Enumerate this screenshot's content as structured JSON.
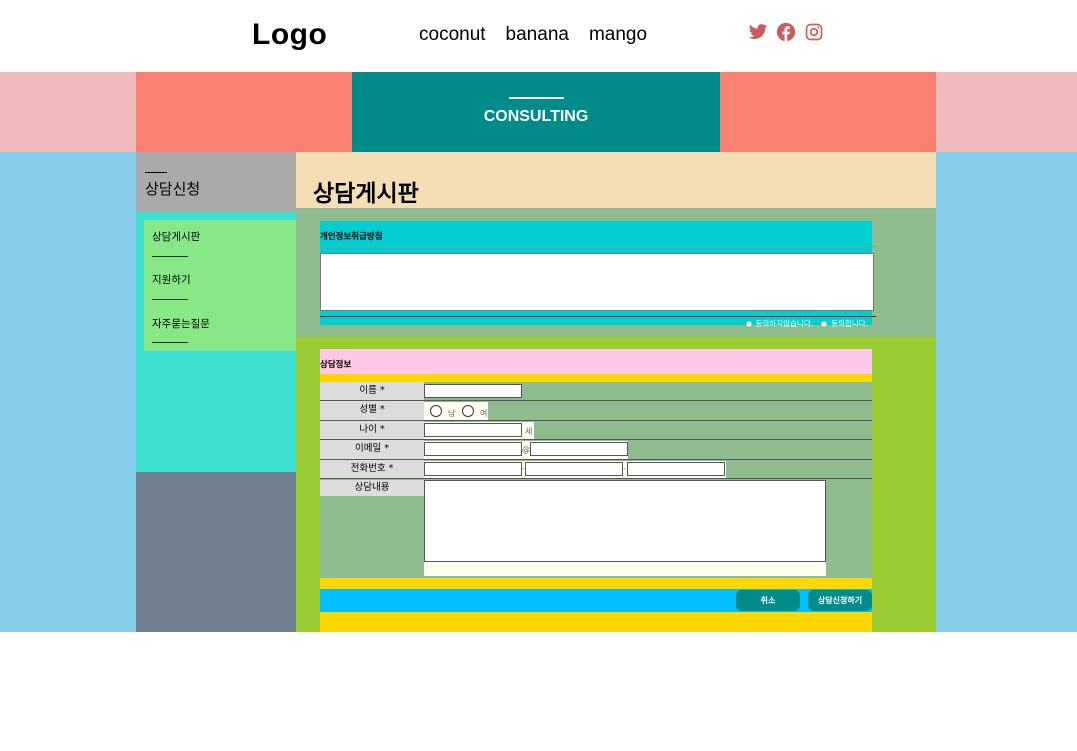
{
  "header": {
    "logo": "Logo",
    "nav": [
      "coconut",
      "banana",
      "mango"
    ],
    "social_icons": [
      "twitter-icon",
      "facebook-icon",
      "instagram-icon"
    ],
    "icon_color": "#cd5c5c"
  },
  "banner": {
    "title": "CONSULTING"
  },
  "sidebar": {
    "title": "상담신청",
    "items": [
      "상담게시판",
      "지원하기",
      "자주묻는질문"
    ]
  },
  "main": {
    "title": "상담게시판",
    "privacy": {
      "label": "개인정보취급방침",
      "disagree": "동의하지않습니다.",
      "agree": "동의합니다."
    },
    "form": {
      "title": "상담정보",
      "name_label": "이름 *",
      "gender_label": "성별 *",
      "gender_male": "남",
      "gender_female": "여",
      "age_label": "나이 *",
      "age_unit": "세",
      "email_label": "이메일 *",
      "email_at": "@",
      "phone_label": "전화번호 *",
      "phone_sep": "-",
      "content_label": "상담내용",
      "cancel": "취소",
      "submit": "상담신청하기"
    }
  },
  "colors": {
    "salmon": "#fa8072",
    "teal": "#008b8b",
    "skyblue": "#87ceeb",
    "wheat": "#f5deb3",
    "yellowgreen": "#9acd32",
    "gold": "#ffd700",
    "deepskyblue": "#00bfff"
  }
}
